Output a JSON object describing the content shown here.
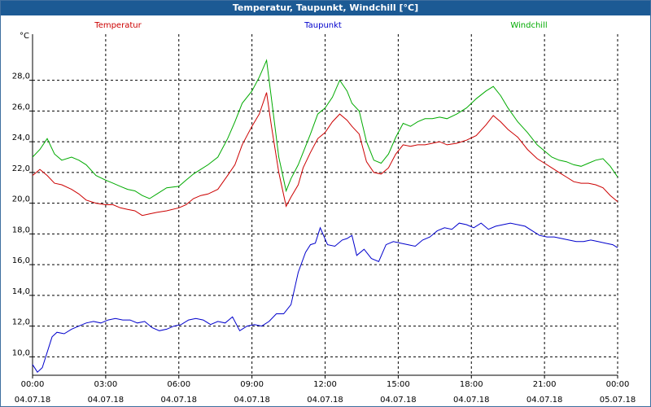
{
  "window": {
    "title": "Temperatur, Taupunkt, Windchill [°C]"
  },
  "chart_data": {
    "type": "line",
    "title": "Temperatur, Taupunkt, Windchill [°C]",
    "ylabel": "°C",
    "ylim": [
      8.8,
      31.0
    ],
    "yticks": [
      "10,0",
      "12,0",
      "14,0",
      "16,0",
      "18,0",
      "20,0",
      "22,0",
      "24,0",
      "26,0",
      "28,0"
    ],
    "ytick_values": [
      10,
      12,
      14,
      16,
      18,
      20,
      22,
      24,
      26,
      28
    ],
    "xlim": [
      0,
      24
    ],
    "xticks": [
      {
        "time": "00:00",
        "date": "04.07.18"
      },
      {
        "time": "03:00",
        "date": "04.07.18"
      },
      {
        "time": "06:00",
        "date": "04.07.18"
      },
      {
        "time": "09:00",
        "date": "04.07.18"
      },
      {
        "time": "12:00",
        "date": "04.07.18"
      },
      {
        "time": "15:00",
        "date": "04.07.18"
      },
      {
        "time": "18:00",
        "date": "04.07.18"
      },
      {
        "time": "21:00",
        "date": "04.07.18"
      },
      {
        "time": "00:00",
        "date": "05.07.18"
      }
    ],
    "grid": true,
    "legend_position": "top",
    "series": [
      {
        "name": "Temperatur",
        "color": "#cc0000",
        "x": [
          0,
          0.3,
          0.6,
          0.9,
          1.2,
          1.6,
          1.9,
          2.2,
          2.6,
          3.0,
          3.3,
          3.6,
          3.9,
          4.2,
          4.5,
          4.8,
          5.1,
          5.5,
          6.0,
          6.3,
          6.6,
          6.9,
          7.2,
          7.6,
          8.0,
          8.3,
          8.6,
          9.0,
          9.3,
          9.6,
          9.8,
          10.1,
          10.4,
          10.6,
          10.9,
          11.1,
          11.4,
          11.7,
          12.0,
          12.3,
          12.6,
          12.9,
          13.1,
          13.4,
          13.7,
          14.0,
          14.3,
          14.6,
          14.9,
          15.2,
          15.5,
          15.8,
          16.1,
          16.4,
          16.7,
          17.0,
          17.4,
          17.8,
          18.2,
          18.6,
          18.9,
          19.2,
          19.5,
          19.9,
          20.3,
          20.7,
          21.0,
          21.3,
          21.6,
          21.9,
          22.2,
          22.5,
          22.8,
          23.1,
          23.4,
          23.7,
          24.0
        ],
        "y": [
          21.8,
          22.2,
          21.8,
          21.3,
          21.2,
          20.9,
          20.6,
          20.2,
          20.0,
          19.9,
          19.9,
          19.7,
          19.6,
          19.5,
          19.2,
          19.3,
          19.4,
          19.5,
          19.7,
          19.9,
          20.3,
          20.5,
          20.6,
          20.9,
          21.8,
          22.5,
          23.8,
          25.0,
          25.8,
          27.2,
          25.0,
          22.0,
          19.8,
          20.4,
          21.2,
          22.3,
          23.3,
          24.2,
          24.6,
          25.3,
          25.8,
          25.4,
          25.0,
          24.5,
          22.7,
          22.0,
          21.9,
          22.3,
          23.2,
          23.8,
          23.7,
          23.8,
          23.8,
          23.9,
          24.0,
          23.8,
          23.9,
          24.1,
          24.4,
          25.1,
          25.7,
          25.3,
          24.8,
          24.3,
          23.5,
          22.9,
          22.6,
          22.3,
          22.0,
          21.7,
          21.4,
          21.3,
          21.3,
          21.2,
          21.0,
          20.5,
          20.1
        ]
      },
      {
        "name": "Taupunkt",
        "color": "#0000cc",
        "x": [
          0,
          0.2,
          0.4,
          0.6,
          0.8,
          1.0,
          1.3,
          1.6,
          1.9,
          2.2,
          2.5,
          2.8,
          3.1,
          3.4,
          3.7,
          4.0,
          4.3,
          4.6,
          4.9,
          5.2,
          5.5,
          5.8,
          6.1,
          6.4,
          6.7,
          7.0,
          7.3,
          7.6,
          7.9,
          8.2,
          8.5,
          8.8,
          9.1,
          9.4,
          9.7,
          10.0,
          10.3,
          10.6,
          10.9,
          11.2,
          11.4,
          11.6,
          11.8,
          12.1,
          12.4,
          12.7,
          12.9,
          13.1,
          13.3,
          13.6,
          13.9,
          14.2,
          14.5,
          14.8,
          15.1,
          15.4,
          15.7,
          16.0,
          16.3,
          16.6,
          16.9,
          17.2,
          17.5,
          17.8,
          18.1,
          18.4,
          18.7,
          19.0,
          19.3,
          19.6,
          19.9,
          20.2,
          20.5,
          20.8,
          21.1,
          21.4,
          21.7,
          22.0,
          22.3,
          22.6,
          22.9,
          23.2,
          23.5,
          23.8,
          24.0
        ],
        "y": [
          9.5,
          9.0,
          9.3,
          10.3,
          11.3,
          11.6,
          11.5,
          11.8,
          12.0,
          12.2,
          12.3,
          12.2,
          12.4,
          12.5,
          12.4,
          12.4,
          12.2,
          12.3,
          11.9,
          11.7,
          11.8,
          12.0,
          12.1,
          12.4,
          12.5,
          12.4,
          12.1,
          12.3,
          12.2,
          12.6,
          11.7,
          12.0,
          12.1,
          12.0,
          12.3,
          12.8,
          12.8,
          13.4,
          15.5,
          16.8,
          17.3,
          17.4,
          18.4,
          17.3,
          17.2,
          17.6,
          17.7,
          17.9,
          16.6,
          17.0,
          16.4,
          16.2,
          17.3,
          17.5,
          17.4,
          17.3,
          17.2,
          17.6,
          17.8,
          18.2,
          18.4,
          18.3,
          18.7,
          18.6,
          18.4,
          18.7,
          18.3,
          18.5,
          18.6,
          18.7,
          18.6,
          18.5,
          18.2,
          17.9,
          17.8,
          17.8,
          17.7,
          17.6,
          17.5,
          17.5,
          17.6,
          17.5,
          17.4,
          17.3,
          17.1
        ]
      },
      {
        "name": "Windchill",
        "color": "#00aa00",
        "x": [
          0,
          0.3,
          0.6,
          0.9,
          1.2,
          1.6,
          1.9,
          2.2,
          2.6,
          3.0,
          3.3,
          3.6,
          3.9,
          4.2,
          4.5,
          4.8,
          5.1,
          5.5,
          6.0,
          6.3,
          6.6,
          6.9,
          7.2,
          7.6,
          8.0,
          8.3,
          8.6,
          9.0,
          9.3,
          9.6,
          9.8,
          10.1,
          10.4,
          10.6,
          10.9,
          11.1,
          11.4,
          11.7,
          12.0,
          12.3,
          12.6,
          12.9,
          13.1,
          13.4,
          13.7,
          14.0,
          14.3,
          14.6,
          14.9,
          15.2,
          15.5,
          15.8,
          16.1,
          16.4,
          16.7,
          17.0,
          17.4,
          17.8,
          18.2,
          18.6,
          18.9,
          19.2,
          19.5,
          19.9,
          20.3,
          20.7,
          21.0,
          21.3,
          21.6,
          21.9,
          22.2,
          22.5,
          22.8,
          23.1,
          23.4,
          23.7,
          24.0
        ],
        "y": [
          23.0,
          23.5,
          24.2,
          23.2,
          22.8,
          23.0,
          22.8,
          22.5,
          21.8,
          21.5,
          21.3,
          21.1,
          20.9,
          20.8,
          20.5,
          20.3,
          20.6,
          21.0,
          21.1,
          21.5,
          21.9,
          22.2,
          22.5,
          23.0,
          24.2,
          25.3,
          26.5,
          27.3,
          28.2,
          29.3,
          26.8,
          23.0,
          20.8,
          21.6,
          22.5,
          23.3,
          24.5,
          25.8,
          26.2,
          26.9,
          28.0,
          27.3,
          26.5,
          26.0,
          24.0,
          22.8,
          22.6,
          23.2,
          24.3,
          25.2,
          25.0,
          25.3,
          25.5,
          25.5,
          25.6,
          25.5,
          25.8,
          26.2,
          26.8,
          27.3,
          27.6,
          27.0,
          26.2,
          25.3,
          24.6,
          23.8,
          23.4,
          23.0,
          22.8,
          22.7,
          22.5,
          22.4,
          22.6,
          22.8,
          22.9,
          22.4,
          21.7
        ]
      }
    ]
  }
}
